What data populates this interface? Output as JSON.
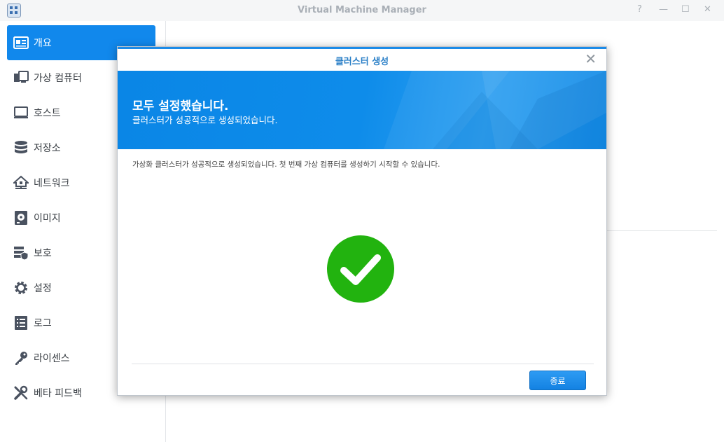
{
  "window": {
    "title": "Virtual Machine Manager",
    "controls": {
      "help": "?",
      "minimize": "—",
      "maximize": "☐",
      "close": "✕"
    }
  },
  "sidebar": {
    "items": [
      {
        "label": "개요",
        "icon": "overview-icon",
        "active": true
      },
      {
        "label": "가상 컴퓨터",
        "icon": "virtual-machine-icon"
      },
      {
        "label": "호스트",
        "icon": "host-monitor-icon"
      },
      {
        "label": "저장소",
        "icon": "storage-database-icon"
      },
      {
        "label": "네트워크",
        "icon": "network-icon"
      },
      {
        "label": "이미지",
        "icon": "disk-image-icon"
      },
      {
        "label": "보호",
        "icon": "protection-icon"
      },
      {
        "label": "설정",
        "icon": "gear-icon"
      },
      {
        "label": "로그",
        "icon": "log-list-icon"
      },
      {
        "label": "라이센스",
        "icon": "license-key-icon"
      },
      {
        "label": "베타 피드백",
        "icon": "wrench-icon"
      }
    ],
    "active_color": "#1188ec"
  },
  "dialog": {
    "title": "클러스터 생성",
    "close": "✕",
    "banner": {
      "heading": "모두 설정했습니다.",
      "subheading": "클러스터가 성공적으로 생성되었습니다."
    },
    "description": "가상화 클러스터가 성공적으로 생성되었습니다. 첫 번째 가상 컴퓨터를 생성하기 시작할 수 있습니다.",
    "status_icon": "success-check-icon",
    "success_color": "#22b30f",
    "finish_button": "종료"
  }
}
